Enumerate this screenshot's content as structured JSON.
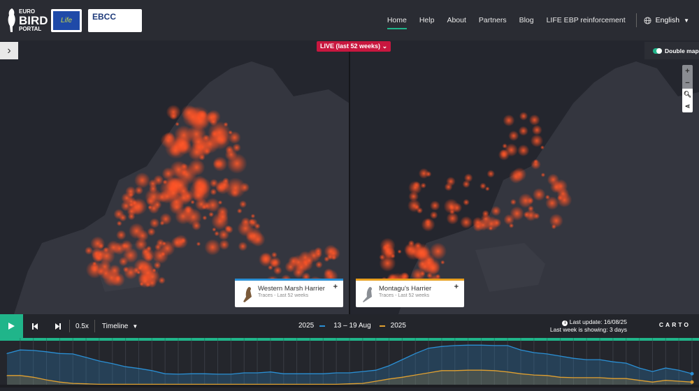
{
  "header": {
    "logo_text": [
      "EURO",
      "BIRD",
      "PORTAL"
    ],
    "life_logo": "Life",
    "ebcc_logo": "EBCC",
    "nav": [
      "Home",
      "Help",
      "About",
      "Partners",
      "Blog",
      "LIFE EBP reinforcement"
    ],
    "language": "English"
  },
  "map": {
    "live_label": "LIVE (last 52 weeks)",
    "double_map_label": "Double map",
    "zoom_in": "+",
    "zoom_out": "−"
  },
  "cards": [
    {
      "name": "Western Marsh Harrier",
      "sub": "Traces - Last 52 weeks",
      "color": "#2a8fd4"
    },
    {
      "name": "Montagu's Harrier",
      "sub": "Traces - Last 52 weeks",
      "color": "#e8a020"
    }
  ],
  "controls": {
    "speed": "0.5x",
    "mode": "Timeline",
    "year_left": "2025",
    "week": "13 – 19 Aug",
    "year_right": "2025",
    "last_update": "Last update: 16/08/25",
    "showing": "Last week is showing: 3 days",
    "carto": "CARTO"
  },
  "chart_data": {
    "type": "area",
    "x_label": "week",
    "weeks": 52,
    "series": [
      {
        "name": "Western Marsh Harrier",
        "color": "#2a8fd4",
        "values": [
          71,
          79,
          78,
          75,
          71,
          70,
          62,
          54,
          48,
          41,
          37,
          32,
          25,
          24,
          25,
          25,
          24,
          24,
          27,
          27,
          29,
          25,
          25,
          25,
          25,
          27,
          27,
          30,
          33,
          43,
          57,
          71,
          83,
          87,
          89,
          90,
          90,
          89,
          89,
          79,
          73,
          70,
          65,
          60,
          57,
          57,
          52,
          49,
          38,
          30,
          38,
          33,
          25
        ]
      },
      {
        "name": "Montagu's Harrier",
        "color": "#e0a030",
        "values": [
          21,
          21,
          17,
          11,
          6,
          3,
          2,
          1,
          1,
          1,
          1,
          1,
          1,
          1,
          1,
          1,
          1,
          1,
          1,
          1,
          1,
          1,
          1,
          1,
          1,
          1,
          2,
          3,
          8,
          13,
          17,
          22,
          27,
          32,
          32,
          33,
          33,
          32,
          29,
          25,
          22,
          21,
          17,
          16,
          16,
          16,
          14,
          14,
          10,
          6,
          10,
          8,
          6
        ]
      }
    ],
    "ylim": [
      0,
      100
    ]
  }
}
